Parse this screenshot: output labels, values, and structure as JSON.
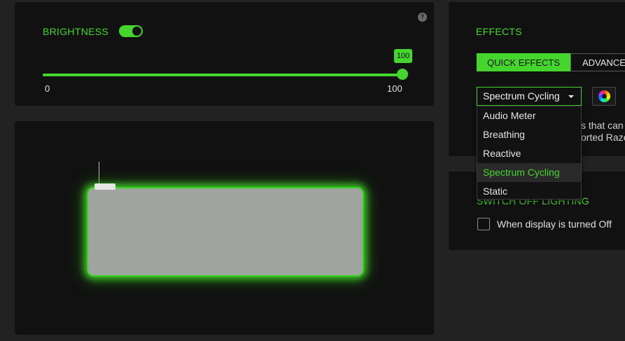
{
  "brightness": {
    "title": "BRIGHTNESS",
    "toggle_on": true,
    "help": "?",
    "slider": {
      "value": 100,
      "value_label": "100",
      "min_label": "0",
      "max_label": "100"
    }
  },
  "effects": {
    "title": "EFFECTS",
    "tabs": [
      {
        "label": "QUICK EFFECTS",
        "active": true
      },
      {
        "label": "ADVANCED",
        "active": false
      }
    ],
    "selected_effect": "Spectrum Cycling",
    "description_line1": "s that can",
    "description_line2": "orted Razer"
  },
  "dropdown": {
    "options": [
      {
        "label": "Audio Meter"
      },
      {
        "label": "Breathing"
      },
      {
        "label": "Reactive"
      },
      {
        "label": "Spectrum Cycling",
        "selected": true
      },
      {
        "label": "Static"
      }
    ]
  },
  "switch_off": {
    "title": "SWITCH OFF LIGHTING",
    "checkbox_label": "When display is turned Off",
    "checked": false
  },
  "colors": {
    "accent": "#44d62c",
    "panel": "#111111",
    "background": "#222222"
  }
}
